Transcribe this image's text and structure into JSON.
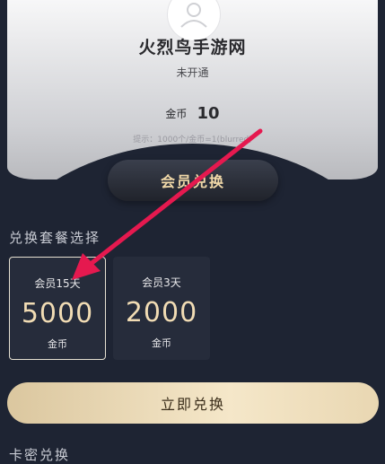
{
  "profile": {
    "name": "火烈鸟手游网",
    "status": "未开通",
    "coin_label": "金币",
    "coin_value": "10",
    "hint": "提示：1000个/金币=1(blurred)"
  },
  "vip_button": "会员兑换",
  "packages_section": {
    "title": "兑换套餐选择"
  },
  "packages": [
    {
      "duration": "会员15天",
      "amount": "5000",
      "unit": "金币",
      "selected": true
    },
    {
      "duration": "会员3天",
      "amount": "2000",
      "unit": "金币",
      "selected": false
    }
  ],
  "redeem_button": "立即兑换",
  "card_section": {
    "title": "卡密兑换"
  },
  "colors": {
    "arrow": "#e5194f",
    "gold": "#f1dcb4",
    "background": "#1e2433"
  },
  "icons": {
    "avatar": "user-avatar-icon",
    "annotation": "red-arrow-annotation"
  }
}
